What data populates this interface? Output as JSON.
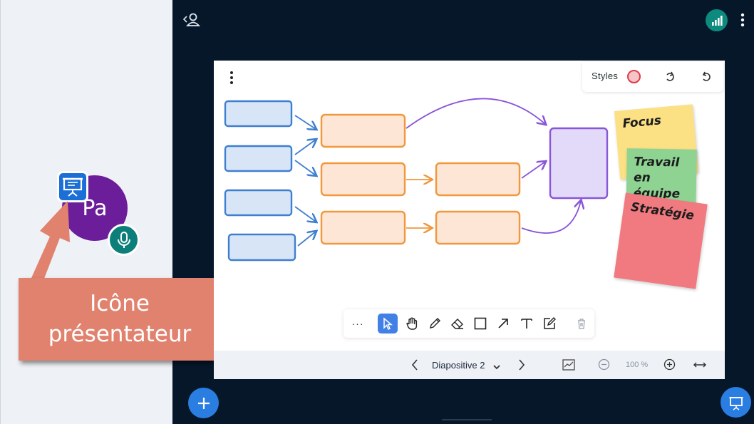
{
  "user": {
    "initials": "Pa"
  },
  "callout": {
    "line1": "Icône",
    "line2": "présentateur"
  },
  "whiteboard": {
    "styles_label": "Styles",
    "style_color": "#e03a4a"
  },
  "stickies": {
    "yellow": "Focus",
    "green": "Travail en équipe",
    "red": "Stratégie"
  },
  "toolbar": {
    "more_label": "···",
    "tools": [
      "select-icon",
      "hand-icon",
      "pencil-icon",
      "eraser-icon",
      "rectangle-icon",
      "arrow-icon",
      "text-icon",
      "note-icon"
    ],
    "active_tool": "select-icon"
  },
  "navigation": {
    "slide_name": "Diapositive 2",
    "zoom_level": "100 %"
  },
  "colors": {
    "accent": "#2a7de1",
    "background": "#06172a",
    "presenter_avatar": "#6b1d9a",
    "callout": "#e1826f"
  }
}
